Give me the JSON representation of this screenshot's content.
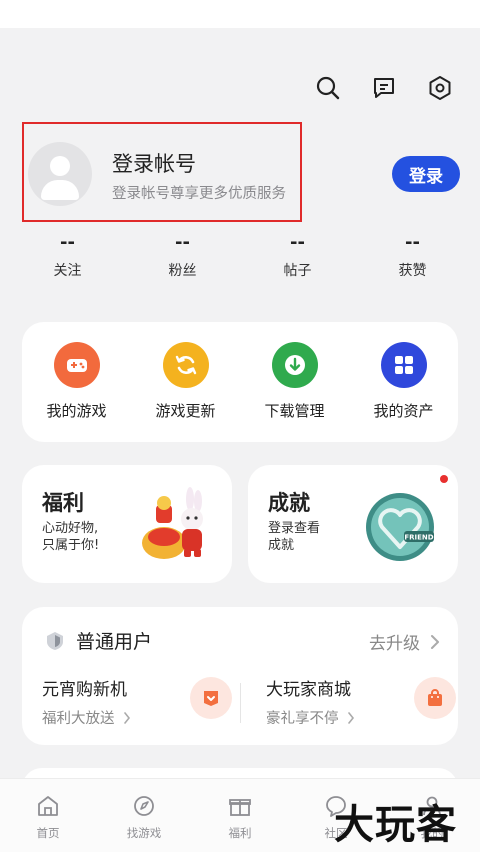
{
  "header": {
    "icons": [
      "search-icon",
      "message-icon",
      "settings-icon"
    ]
  },
  "profile": {
    "title": "登录帐号",
    "subtitle": "登录帐号尊享更多优质服务",
    "login_button": "登录"
  },
  "stats": [
    {
      "value": "--",
      "label": "关注"
    },
    {
      "value": "--",
      "label": "粉丝"
    },
    {
      "value": "--",
      "label": "帖子"
    },
    {
      "value": "--",
      "label": "获赞"
    }
  ],
  "tools": [
    {
      "label": "我的游戏",
      "icon": "gamepad-icon",
      "color": "#f26a3d"
    },
    {
      "label": "游戏更新",
      "icon": "refresh-icon",
      "color": "#f4b21f"
    },
    {
      "label": "下载管理",
      "icon": "download-icon",
      "color": "#2faa4d"
    },
    {
      "label": "我的资产",
      "icon": "grid-icon",
      "color": "#2f48dc"
    }
  ],
  "welfare": {
    "title": "福利",
    "line1": "心动好物,",
    "line2": "只属于你!"
  },
  "achievement": {
    "title": "成就",
    "line1": "登录查看",
    "line2": "成就",
    "badge_text": "FRIEND"
  },
  "member": {
    "level": "普通用户",
    "upgrade": "去升级",
    "promos": [
      {
        "title": "元宵购新机",
        "subtitle": "福利大放送"
      },
      {
        "title": "大玩家商城",
        "subtitle": "豪礼享不停"
      }
    ]
  },
  "tabs": [
    {
      "label": "首页"
    },
    {
      "label": "找游戏"
    },
    {
      "label": "福利"
    },
    {
      "label": "社区"
    },
    {
      "label": "我的"
    }
  ],
  "watermark": "大玩客",
  "colors": {
    "accent": "#2451e0",
    "highlight_border": "#e02a2a",
    "background": "#f2f2f3"
  }
}
